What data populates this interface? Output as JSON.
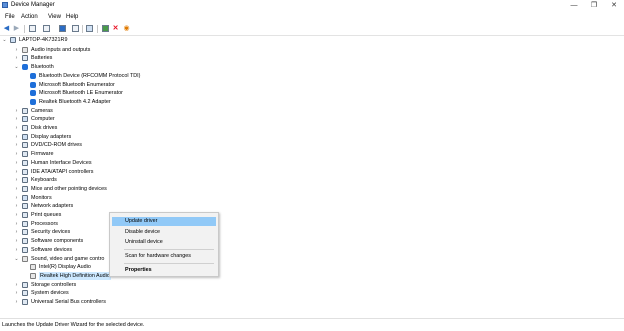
{
  "window": {
    "title": "Device Manager",
    "controls": [
      "—",
      "❐",
      "✕"
    ]
  },
  "menu": [
    "File",
    "Action",
    "View",
    "Help"
  ],
  "toolbar": {
    "icons": [
      "back-arrow-icon",
      "forward-arrow-icon",
      "properties-icon",
      "show-hidden-icon",
      "help-icon",
      "list-icon",
      "monitor-icon",
      "update-driver-icon",
      "uninstall-icon",
      "scan-hardware-icon"
    ],
    "colors": {
      "back": "#2b6cc4",
      "delete": "#e81123",
      "scan": "#e07a00"
    }
  },
  "tree": {
    "root": "LAPTOP-4K7321R9",
    "nodes": [
      {
        "label": "Audio inputs and outputs",
        "icon": "speaker-icon",
        "level": 1,
        "expanded": false
      },
      {
        "label": "Batteries",
        "icon": "battery-icon",
        "level": 1,
        "expanded": false
      },
      {
        "label": "Bluetooth",
        "icon": "bluetooth-icon",
        "level": 1,
        "expanded": true
      },
      {
        "label": "Bluetooth Device (RFCOMM Protocol TDI)",
        "icon": "bluetooth-icon",
        "level": 2
      },
      {
        "label": "Microsoft Bluetooth Enumerator",
        "icon": "bluetooth-icon",
        "level": 2
      },
      {
        "label": "Microsoft Bluetooth LE Enumerator",
        "icon": "bluetooth-icon",
        "level": 2
      },
      {
        "label": "Realtek Bluetooth 4.2 Adapter",
        "icon": "bluetooth-icon",
        "level": 2
      },
      {
        "label": "Cameras",
        "icon": "camera-icon",
        "level": 1,
        "expanded": false
      },
      {
        "label": "Computer",
        "icon": "computer-icon",
        "level": 1,
        "expanded": false
      },
      {
        "label": "Disk drives",
        "icon": "disk-icon",
        "level": 1,
        "expanded": false
      },
      {
        "label": "Display adapters",
        "icon": "display-icon",
        "level": 1,
        "expanded": false
      },
      {
        "label": "DVD/CD-ROM drives",
        "icon": "dvd-icon",
        "level": 1,
        "expanded": false
      },
      {
        "label": "Firmware",
        "icon": "firmware-icon",
        "level": 1,
        "expanded": false
      },
      {
        "label": "Human Interface Devices",
        "icon": "hid-icon",
        "level": 1,
        "expanded": false
      },
      {
        "label": "IDE ATA/ATAPI controllers",
        "icon": "ide-icon",
        "level": 1,
        "expanded": false
      },
      {
        "label": "Keyboards",
        "icon": "keyboard-icon",
        "level": 1,
        "expanded": false
      },
      {
        "label": "Mice and other pointing devices",
        "icon": "mouse-icon",
        "level": 1,
        "expanded": false
      },
      {
        "label": "Monitors",
        "icon": "monitor-icon",
        "level": 1,
        "expanded": false
      },
      {
        "label": "Network adapters",
        "icon": "network-icon",
        "level": 1,
        "expanded": false
      },
      {
        "label": "Print queues",
        "icon": "printer-icon",
        "level": 1,
        "expanded": false
      },
      {
        "label": "Processors",
        "icon": "processor-icon",
        "level": 1,
        "expanded": false
      },
      {
        "label": "Security devices",
        "icon": "security-icon",
        "level": 1,
        "expanded": false
      },
      {
        "label": "Software components",
        "icon": "software-icon",
        "level": 1,
        "expanded": false
      },
      {
        "label": "Software devices",
        "icon": "software-icon",
        "level": 1,
        "expanded": false
      },
      {
        "label": "Sound, video and game contro",
        "icon": "audio-icon",
        "level": 1,
        "expanded": true
      },
      {
        "label": "Intel(R) Display Audio",
        "icon": "audio-icon",
        "level": 2
      },
      {
        "label": "Realtek High Definition Audio",
        "icon": "audio-icon",
        "level": 2,
        "selected": true
      },
      {
        "label": "Storage controllers",
        "icon": "storage-icon",
        "level": 1,
        "expanded": false
      },
      {
        "label": "System devices",
        "icon": "system-icon",
        "level": 1,
        "expanded": false
      },
      {
        "label": "Universal Serial Bus controllers",
        "icon": "usb-icon",
        "level": 1,
        "expanded": false
      }
    ]
  },
  "context_menu": {
    "items": [
      {
        "label": "Update driver",
        "highlighted": true
      },
      {
        "label": "Disable device"
      },
      {
        "label": "Uninstall device"
      },
      {
        "label": "Scan for hardware changes",
        "separator_before": true
      },
      {
        "label": "Properties",
        "bold": true,
        "separator_before": true
      }
    ]
  },
  "status": "Launches the Update Driver Wizard for the selected device."
}
